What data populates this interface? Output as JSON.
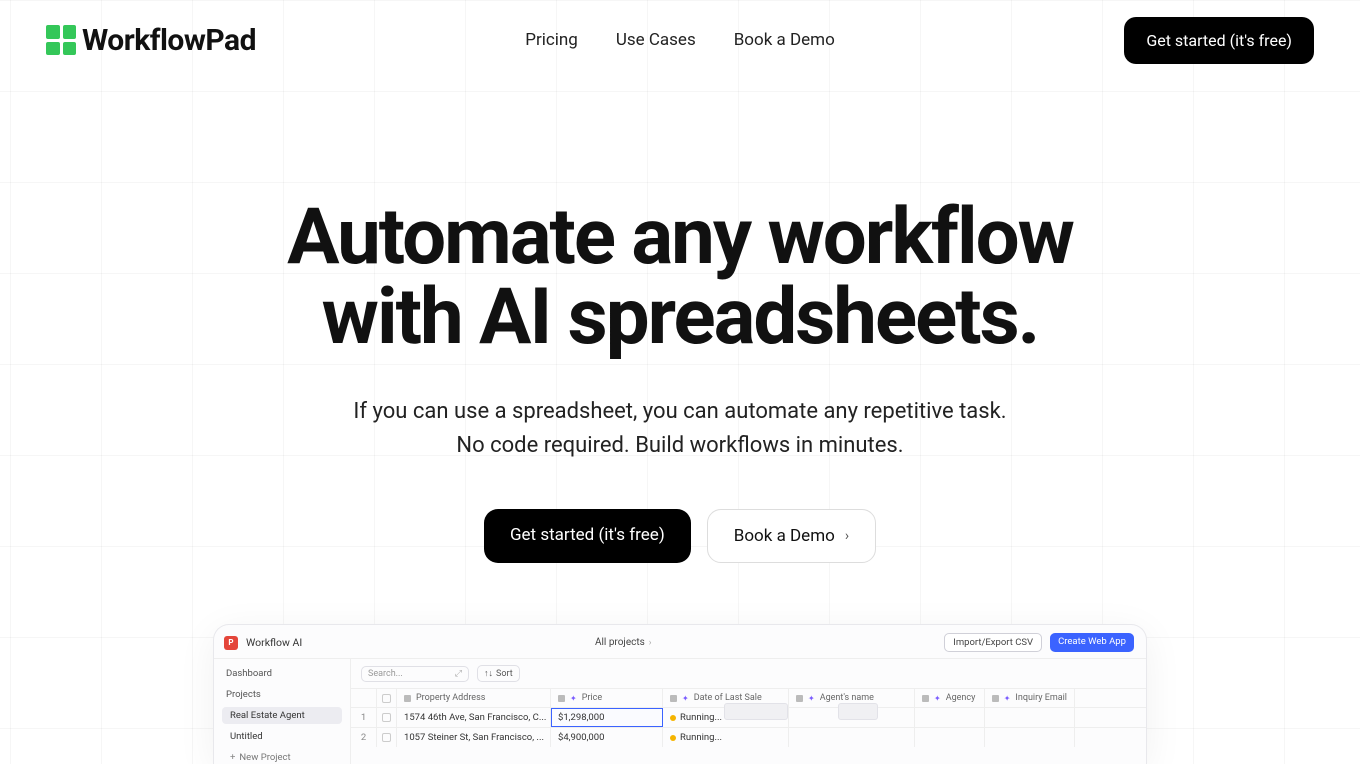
{
  "brand": {
    "name": "WorkflowPad"
  },
  "nav": {
    "links": [
      "Pricing",
      "Use Cases",
      "Book a Demo"
    ],
    "cta": "Get started (it's free)"
  },
  "hero": {
    "headline_l1": "Automate any workflow",
    "headline_l2": "with AI spreadsheets.",
    "sub_l1": "If you can use a spreadsheet, you can automate any repetitive task.",
    "sub_l2": "No code required. Build workflows in minutes.",
    "primary_cta": "Get started (it's free)",
    "secondary_cta": "Book a Demo"
  },
  "preview": {
    "app_name": "Workflow AI",
    "breadcrumb": "All projects",
    "top_buttons": {
      "outline": "Import/Export CSV",
      "solid": "Create Web App"
    },
    "sidebar": {
      "items": [
        {
          "label": "Dashboard",
          "type": "label"
        },
        {
          "label": "Projects",
          "type": "label"
        },
        {
          "label": "Real Estate Agent",
          "type": "item",
          "active": true
        },
        {
          "label": "Untitled",
          "type": "item"
        },
        {
          "label": "New Project",
          "type": "add"
        }
      ]
    },
    "toolbar": {
      "search_placeholder": "Search...",
      "sort_label": "Sort"
    },
    "columns": [
      "Property Address",
      "Price",
      "Date of Last Sale",
      "Agent's name",
      "Agency",
      "Inquiry Email"
    ],
    "rows": [
      {
        "idx": "1",
        "address": "1574 46th Ave, San Francisco, C...",
        "price": "$1,298,000",
        "date": "Running...",
        "agent": "",
        "agency": "",
        "inquiry": ""
      },
      {
        "idx": "2",
        "address": "1057 Steiner St, San Francisco, ...",
        "price": "$4,900,000",
        "date": "Running...",
        "agent": "",
        "agency": "",
        "inquiry": ""
      }
    ],
    "ghost_labels": [
      "",
      ""
    ]
  }
}
